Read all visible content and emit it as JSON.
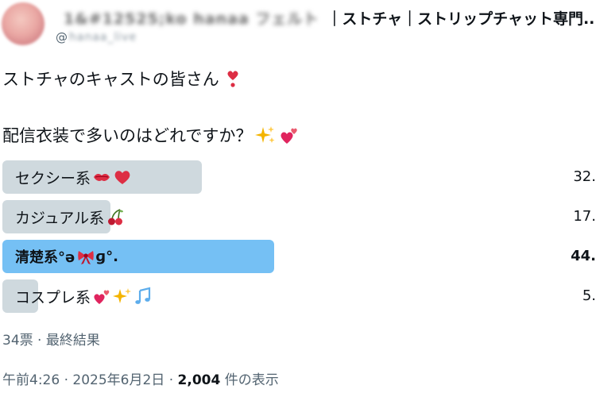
{
  "header": {
    "display_name_blurred": "1&#12525;ko  hanaa  フェルト",
    "display_name_tail": "｜ストチャ｜ストリップチャット専門...",
    "handle_prefix": "@",
    "handle_blurred": "hanaa_live",
    "verified_color": "#1d9bf0"
  },
  "tweet": {
    "line1": "ストチャのキャストの皆さん",
    "line1_emoji": "heavy-exclamation-heart",
    "line2": "配信衣装で多いのはどれですか？",
    "line2_emojis": [
      "sparkles",
      "two-hearts"
    ]
  },
  "poll": {
    "options": [
      {
        "label": "セクシー系",
        "emojis": [
          "kiss-mark",
          "red-heart"
        ],
        "percent_text": "32.",
        "fill_fraction": 0.34,
        "winner": false
      },
      {
        "label": "カジュアル系",
        "emojis": [
          "cherries"
        ],
        "percent_text": "17.",
        "fill_fraction": 0.18,
        "winner": false
      },
      {
        "label": "清楚系°ə",
        "label_tail": "ɡ°.",
        "emojis": [
          "ribbon"
        ],
        "percent_text": "44.",
        "fill_fraction": 0.46,
        "winner": true
      },
      {
        "label": "コスプレ系",
        "emojis": [
          "two-hearts",
          "sparkles",
          "musical-notes"
        ],
        "percent_text": "5.",
        "fill_fraction": 0.06,
        "winner": false
      }
    ],
    "bar_color": "#cfd9de",
    "winner_color": "#75c0f4",
    "votes_text": "34票 · 最終結果"
  },
  "meta": {
    "time": "午前4:26",
    "sep": " · ",
    "date": "2025年6月2日",
    "views_count": "2,004",
    "views_label": " 件の表示"
  }
}
